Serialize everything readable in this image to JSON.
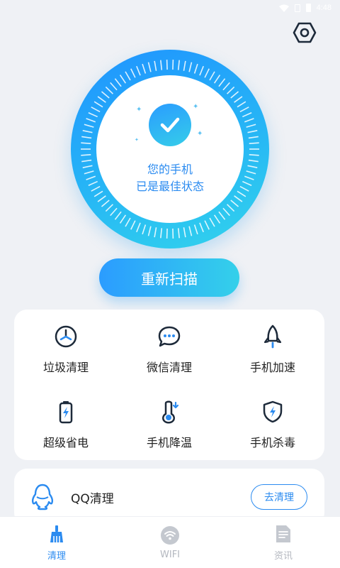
{
  "status_bar": {
    "time": "4:48"
  },
  "colors": {
    "accent": "#2b8bf0",
    "gradient_start": "#1f93ff",
    "gradient_end": "#34d0ea",
    "background": "#eff1f5"
  },
  "gauge": {
    "line1": "您的手机",
    "line2": "已是最佳状态",
    "icon": "check-icon"
  },
  "rescan_button": "重新扫描",
  "tools": [
    {
      "label": "垃圾清理",
      "icon": "clock-sweep-icon"
    },
    {
      "label": "微信清理",
      "icon": "chat-bubble-icon"
    },
    {
      "label": "手机加速",
      "icon": "rocket-icon"
    },
    {
      "label": "超级省电",
      "icon": "battery-bolt-icon"
    },
    {
      "label": "手机降温",
      "icon": "thermometer-icon"
    },
    {
      "label": "手机杀毒",
      "icon": "shield-bolt-icon"
    }
  ],
  "qq_card": {
    "label": "QQ清理",
    "button": "去清理",
    "icon": "penguin-icon"
  },
  "bottom_nav": [
    {
      "label": "清理",
      "icon": "broom-icon",
      "active": true
    },
    {
      "label": "WIFI",
      "icon": "wifi-icon",
      "active": false
    },
    {
      "label": "资讯",
      "icon": "news-icon",
      "active": false
    }
  ]
}
